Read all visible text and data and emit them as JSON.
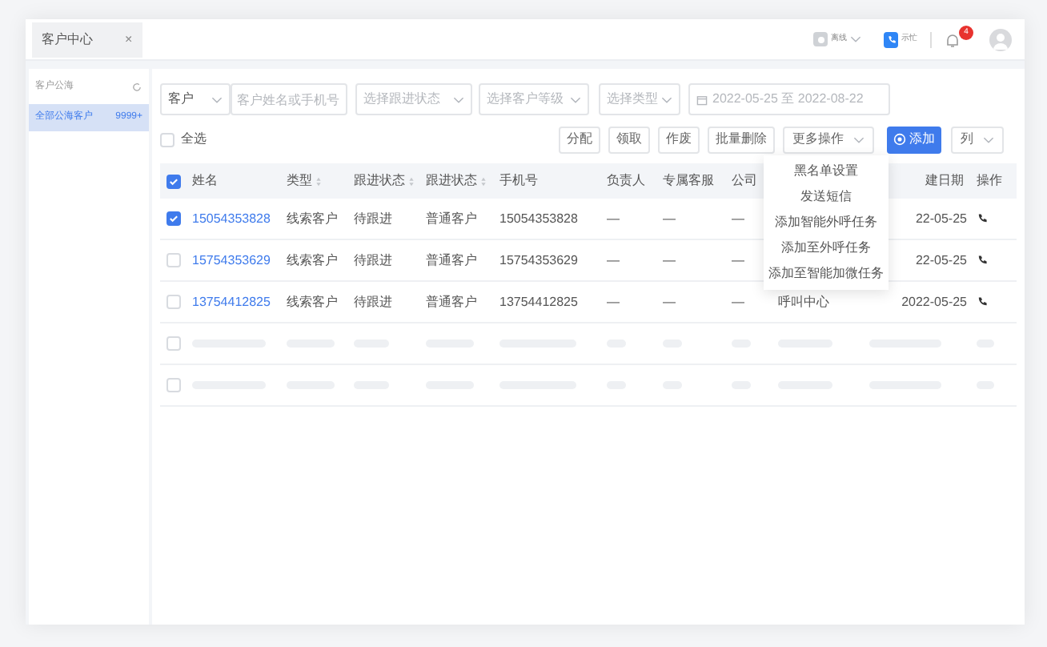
{
  "tabs": [
    {
      "label": "客户中心",
      "close": "×",
      "selected": true
    }
  ],
  "header": {
    "presence": {
      "label": "离线"
    },
    "busy": {
      "label": "示忙"
    },
    "notifications": {
      "count": "4"
    }
  },
  "sidebar": {
    "title": "客户公海",
    "items": [
      {
        "label": "全部公海客户",
        "count": "9999+",
        "selected": true
      }
    ]
  },
  "filters": {
    "scope": {
      "value": "客户"
    },
    "search": {
      "placeholder": "客户姓名或手机号"
    },
    "follow_status": {
      "placeholder": "选择跟进状态"
    },
    "level": {
      "placeholder": "选择客户等级"
    },
    "type": {
      "placeholder": "选择类型"
    },
    "date_range": {
      "start": "2022-05-25",
      "separator": "至",
      "end": "2022-08-22"
    }
  },
  "toolbar": {
    "select_all": {
      "label": "全选",
      "checked": false
    },
    "buttons": [
      {
        "label": "分配",
        "kind": "plain"
      },
      {
        "label": "领取",
        "kind": "plain"
      },
      {
        "label": "作废",
        "kind": "plain"
      },
      {
        "label": "批量删除",
        "kind": "plain"
      },
      {
        "label": "更多操作",
        "kind": "dropdown"
      },
      {
        "label": "添加",
        "kind": "primary"
      },
      {
        "label": "列",
        "kind": "dropdown"
      }
    ]
  },
  "more_menu": {
    "open": true,
    "items": [
      "黑名单设置",
      "发送短信",
      "添加智能外呼任务",
      "添加至外呼任务",
      "添加至智能加微任务"
    ]
  },
  "table": {
    "header_checked": true,
    "columns": [
      {
        "label": "姓名",
        "sortable": false
      },
      {
        "label": "类型",
        "sortable": true
      },
      {
        "label": "跟进状态",
        "sortable": true
      },
      {
        "label": "跟进状态",
        "sortable": true
      },
      {
        "label": "手机号",
        "sortable": false
      },
      {
        "label": "负责人",
        "sortable": false
      },
      {
        "label": "专属客服",
        "sortable": false
      },
      {
        "label": "公司",
        "sortable": false
      },
      {
        "label": "建日期",
        "sortable": false
      },
      {
        "label": "操作",
        "sortable": false
      }
    ],
    "rows": [
      {
        "kind": "data",
        "selected": true,
        "name": "15054353828",
        "type": "线索客户",
        "follow_status": "待跟进",
        "follow_status_2": "普通客户",
        "phone": "15054353828",
        "owner": "—",
        "service": "—",
        "company": "—",
        "date": "22-05-25"
      },
      {
        "kind": "data",
        "selected": false,
        "name": "15754353629",
        "type": "线索客户",
        "follow_status": "待跟进",
        "follow_status_2": "普通客户",
        "phone": "15754353629",
        "owner": "—",
        "service": "—",
        "company": "—",
        "date": "22-05-25"
      },
      {
        "kind": "data",
        "selected": false,
        "name": "13754412825",
        "type": "线索客户",
        "follow_status": "待跟进",
        "follow_status_2": "普通客户",
        "phone": "13754412825",
        "owner": "—",
        "service": "—",
        "company": "—",
        "column_9": "呼叫中心",
        "date": "2022-05-25"
      },
      {
        "kind": "skeleton",
        "selected": false
      },
      {
        "kind": "skeleton",
        "selected": false
      }
    ]
  }
}
